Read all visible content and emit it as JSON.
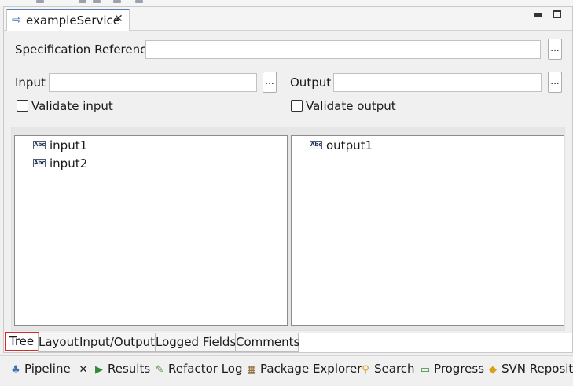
{
  "editor": {
    "tab_title": "exampleService",
    "tab_icon": "arrow-right-icon",
    "spec_ref_label": "Specification Reference",
    "spec_ref_value": "",
    "browse_label": "...",
    "input_label": "Input",
    "input_value": "",
    "output_label": "Output",
    "output_value": "",
    "validate_input_label": "Validate input",
    "validate_output_label": "Validate output",
    "validate_input_checked": false,
    "validate_output_checked": false
  },
  "tree": {
    "inputs": [
      {
        "label": "input1",
        "icon": "abc-string-icon",
        "icon_text": "Abc"
      },
      {
        "label": "input2",
        "icon": "abc-string-icon",
        "icon_text": "Abc"
      }
    ],
    "outputs": [
      {
        "label": "output1",
        "icon": "abc-string-icon",
        "icon_text": "Abc"
      }
    ]
  },
  "page_tabs": [
    {
      "label": "Tree",
      "active": true
    },
    {
      "label": "Layout",
      "active": false
    },
    {
      "label": "Input/Output",
      "active": false
    },
    {
      "label": "Logged Fields",
      "active": false
    },
    {
      "label": "Comments",
      "active": false
    }
  ],
  "views": [
    {
      "label": "Pipeline",
      "icon": "pipeline-icon",
      "active": true
    },
    {
      "label": "Results",
      "icon": "results-icon"
    },
    {
      "label": "Refactor Log",
      "icon": "refactor-log-icon"
    },
    {
      "label": "Package Explorer",
      "icon": "package-explorer-icon"
    },
    {
      "label": "Search",
      "icon": "search-icon"
    },
    {
      "label": "Progress",
      "icon": "progress-icon"
    },
    {
      "label": "SVN Reposito",
      "icon": "svn-repository-icon"
    }
  ],
  "colors": {
    "active_tab_border": "#d62a2a",
    "editor_tab_accent": "#5b7fb5"
  }
}
